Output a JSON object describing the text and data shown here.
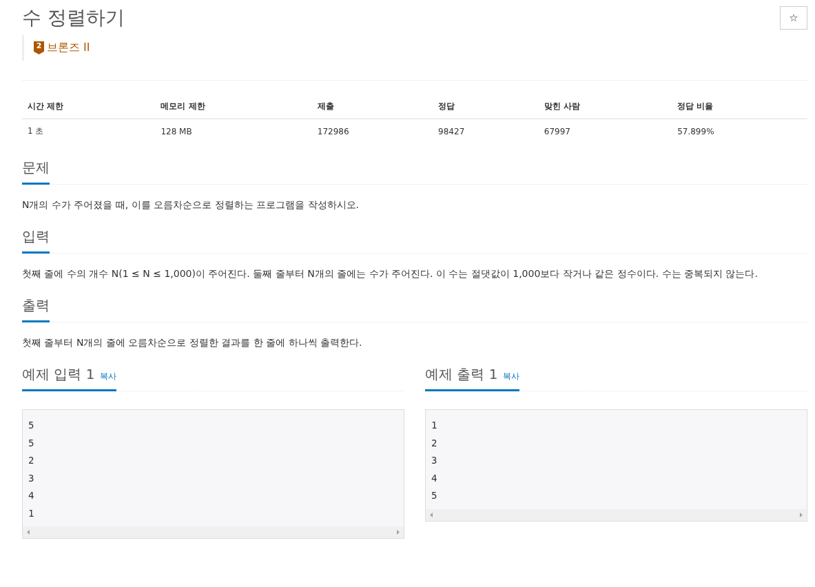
{
  "title": "수 정렬하기",
  "star_button": "☆",
  "tier": {
    "number": "2",
    "label": "브론즈 II",
    "color": "#ad5600"
  },
  "info_table": {
    "columns": [
      "시간 제한",
      "메모리 제한",
      "제출",
      "정답",
      "맞힌 사람",
      "정답 비율"
    ],
    "rows": [
      [
        "1 초",
        "128 MB",
        "172986",
        "98427",
        "67997",
        "57.899%"
      ]
    ]
  },
  "sections": [
    {
      "heading": "문제",
      "text": "N개의 수가 주어졌을 때, 이를 오름차순으로 정렬하는 프로그램을 작성하시오."
    },
    {
      "heading": "입력",
      "text": "첫째 줄에 수의 개수 N(1 ≤ N ≤ 1,000)이 주어진다. 둘째 줄부터 N개의 줄에는 수가 주어진다. 이 수는 절댓값이 1,000보다 작거나 같은 정수이다. 수는 중복되지 않는다."
    },
    {
      "heading": "출력",
      "text": "첫째 줄부터 N개의 줄에 오름차순으로 정렬한 결과를 한 줄에 하나씩 출력한다."
    }
  ],
  "samples": [
    {
      "heading": "예제 입력 1",
      "copy": "복사",
      "lines": [
        "5",
        "5",
        "2",
        "3",
        "4",
        "1"
      ]
    },
    {
      "heading": "예제 출력 1",
      "copy": "복사",
      "lines": [
        "1",
        "2",
        "3",
        "4",
        "5"
      ]
    }
  ]
}
